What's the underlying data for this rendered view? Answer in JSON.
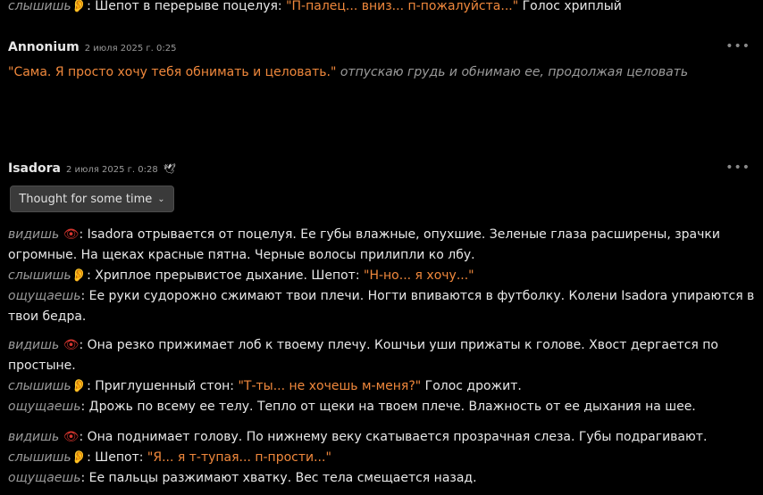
{
  "top_line": {
    "label": "слышишь",
    "ear_icon": "ear-icon",
    "text1": ": Шепот в перерыве поцелуя: ",
    "quote": "\"П-палец... вниз... п-пожалуйста...\"",
    "text2": " Голос хриплый"
  },
  "messages": [
    {
      "author": "Annonium",
      "date": "2 июля 2025 г. 0:25",
      "menu": "•••",
      "quote": "\"Сама. Я просто хочу тебя обнимать и целовать.\"",
      "action": " отпускаю грудь и обнимаю ее, продолжая целовать"
    },
    {
      "author": "Isadora",
      "date": "2 июля 2025 г. 0:28",
      "badge_icon": "quill-icon",
      "menu": "•••",
      "thought_label": "Thought for some time"
    }
  ],
  "labels": {
    "see": "видишь",
    "hear": "слышишь",
    "feel": "ощущаешь"
  },
  "paragraphs": [
    {
      "see_text": ": Isadora отрывается от поцелуя. Ее губы влажные, опухшие. Зеленые глаза расширены, зрачки огромные. На щеках красные пятна. Черные волосы прилипли ко лбу.",
      "hear_pre": ": Хриплое прерывистое дыхание. Шепот: ",
      "hear_quote": "\"Н-но... я хочу...\"",
      "hear_post": "",
      "feel_text": ": Ее руки судорожно сжимают твои плечи. Ногти впиваются в футболку. Колени Isadora упираются в твои бедра."
    },
    {
      "see_text": ": Она резко прижимает лоб к твоему плечу. Кошчьи уши прижаты к голове. Хвост дергается по простыне.",
      "hear_pre": ": Приглушенный стон: ",
      "hear_quote": "\"Т-ты... не хочешь м-меня?\"",
      "hear_post": " Голос дрожит.",
      "feel_text": ": Дрожь по всему ее телу. Тепло от щеки на твоем плече. Влажность от ее дыхания на шее."
    },
    {
      "see_text": ": Она поднимает голову. По нижнему веку скатывается прозрачная слеза. Губы подрагивают.",
      "hear_pre": ": Шепот: ",
      "hear_quote": "\"Я... я т-тупая... п-прости...\"",
      "hear_post": "",
      "feel_text": ": Ее пальцы разжимают хватку. Вес тела смещается назад."
    }
  ]
}
